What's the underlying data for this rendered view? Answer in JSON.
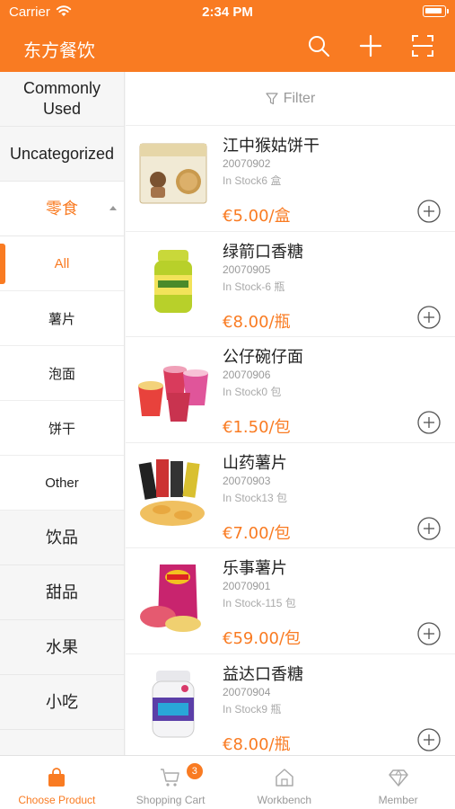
{
  "status_bar": {
    "carrier": "Carrier",
    "time": "2:34 PM"
  },
  "header": {
    "title": "东方餐饮",
    "icons": [
      "search-icon",
      "plus-icon",
      "scan-icon"
    ]
  },
  "sidebar": {
    "categories_top": [
      "Commonly Used",
      "Uncategorized"
    ],
    "expanded_category": "零食",
    "subcategories": [
      {
        "label": "All",
        "active": true
      },
      {
        "label": "薯片"
      },
      {
        "label": "泡面"
      },
      {
        "label": "饼干"
      },
      {
        "label": "Other"
      }
    ],
    "categories_bottom": [
      "饮品",
      "甜品",
      "水果",
      "小吃"
    ]
  },
  "filter": {
    "label": "Filter"
  },
  "products": [
    {
      "name": "江中猴姑饼干",
      "code": "20070902",
      "stock": "In Stock6 盒",
      "price": "€5.00/盒"
    },
    {
      "name": "绿箭口香糖",
      "code": "20070905",
      "stock": "In Stock-6 瓶",
      "price": "€8.00/瓶"
    },
    {
      "name": "公仔碗仔面",
      "code": "20070906",
      "stock": "In Stock0 包",
      "price": "€1.50/包"
    },
    {
      "name": "山药薯片",
      "code": "20070903",
      "stock": "In Stock13 包",
      "price": "€7.00/包"
    },
    {
      "name": "乐事薯片",
      "code": "20070901",
      "stock": "In Stock-115 包",
      "price": "€59.00/包"
    },
    {
      "name": "益达口香糖",
      "code": "20070904",
      "stock": "In Stock9 瓶",
      "price": "€8.00/瓶"
    }
  ],
  "tabbar": {
    "tabs": [
      {
        "label": "Choose Product",
        "active": true
      },
      {
        "label": "Shopping Cart",
        "badge": "3"
      },
      {
        "label": "Workbench"
      },
      {
        "label": "Member"
      }
    ]
  },
  "colors": {
    "accent": "#f97b22"
  }
}
